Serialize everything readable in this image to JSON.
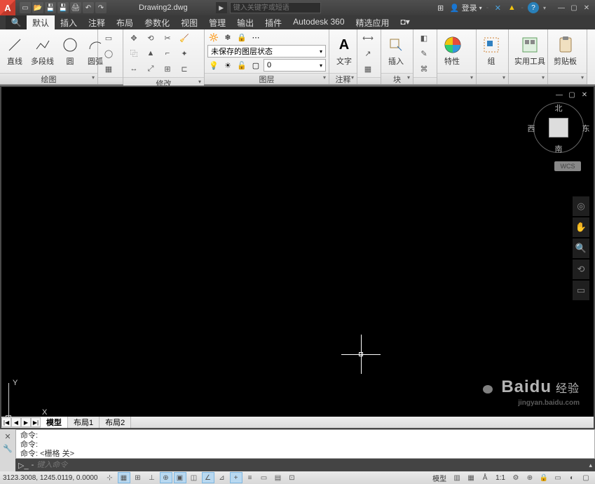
{
  "titlebar": {
    "logo": "A",
    "docname": "Drawing2.dwg",
    "search_placeholder": "键入关键字或短语",
    "login": "登录",
    "help": "?"
  },
  "tabs": [
    "默认",
    "插入",
    "注释",
    "布局",
    "参数化",
    "视图",
    "管理",
    "输出",
    "插件",
    "Autodesk 360",
    "精选应用"
  ],
  "ribbon": {
    "draw": {
      "title": "绘图",
      "btns": [
        "直线",
        "多段线",
        "圆",
        "圆弧"
      ]
    },
    "modify": {
      "title": "修改"
    },
    "layer": {
      "title": "图层",
      "combo": "未保存的图层状态",
      "current": "0"
    },
    "text": {
      "title": "注释",
      "label": "文字"
    },
    "block": {
      "title": "块",
      "label": "插入"
    },
    "p6": {
      "title": "特性"
    },
    "p7": {
      "title": "组"
    },
    "p8": {
      "title": "实用工具"
    },
    "p9": {
      "title": "剪贴板"
    }
  },
  "viewcube": {
    "n": "北",
    "s": "南",
    "e": "东",
    "w": "西",
    "wcs": "WCS"
  },
  "ucs": {
    "x": "X",
    "y": "Y"
  },
  "layouttabs": [
    "模型",
    "布局1",
    "布局2"
  ],
  "command": {
    "line1": "命令:",
    "line2": "命令:",
    "line3": "命令: <栅格 关>",
    "placeholder": "键入命令"
  },
  "status": {
    "coords": "3123.3008, 1245.0119, 0.0000",
    "model": "模型",
    "scale": "1:1"
  },
  "watermark": {
    "brand": "Baidu",
    "sub": "经验",
    "url": "jingyan.baidu.com"
  }
}
